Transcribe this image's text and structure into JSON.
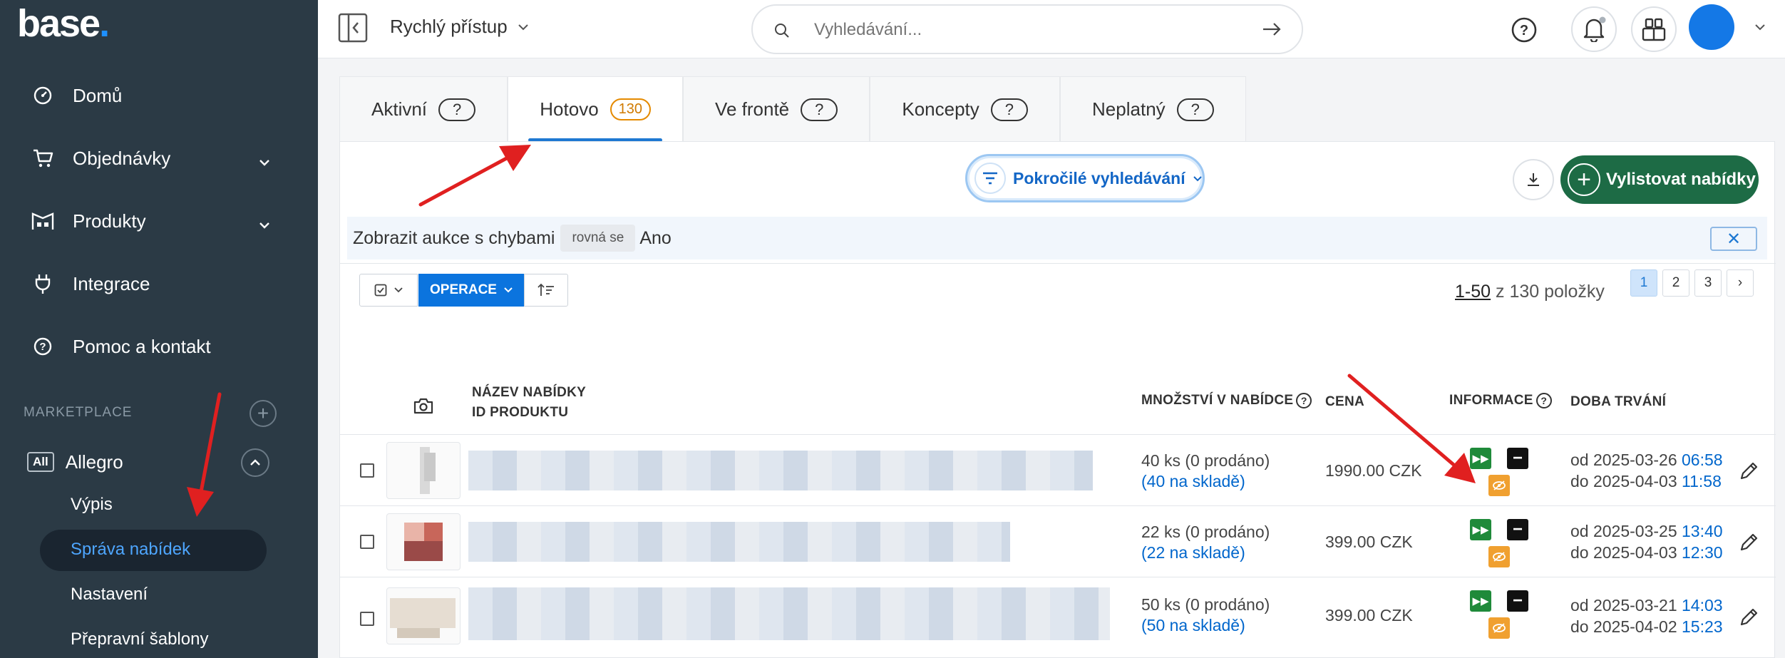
{
  "sidebar": {
    "logo": "base",
    "nav": [
      {
        "label": "Domů",
        "icon": "dashboard-icon"
      },
      {
        "label": "Objednávky",
        "icon": "cart-icon"
      },
      {
        "label": "Produkty",
        "icon": "warehouse-icon"
      },
      {
        "label": "Integrace",
        "icon": "plug-icon"
      },
      {
        "label": "Pomoc a kontakt",
        "icon": "help-icon"
      }
    ],
    "marketplace_label": "MARKETPLACE",
    "allegro_badge": "All",
    "allegro_label": "Allegro",
    "sub_items": [
      "Výpis",
      "Správa nabídek",
      "Nastavení",
      "Přepravní šablony"
    ]
  },
  "topbar": {
    "quick_access": "Rychlý přístup",
    "search_placeholder": "Vyhledávání..."
  },
  "tabs": [
    {
      "label": "Aktivní",
      "count": "?"
    },
    {
      "label": "Hotovo",
      "count": "130"
    },
    {
      "label": "Ve frontě",
      "count": "?"
    },
    {
      "label": "Koncepty",
      "count": "?"
    },
    {
      "label": "Neplatný",
      "count": "?"
    }
  ],
  "toolbar": {
    "advanced_search": "Pokročilé vyhledávání",
    "list_offers": "Vylistovat nabídky",
    "operations": "OPERACE"
  },
  "filter": {
    "field": "Zobrazit aukce s chybami",
    "operator": "rovná se",
    "value": "Ano",
    "close": "✕"
  },
  "pagination": {
    "range": "1-50",
    "of_text": "z 130 položky",
    "pages": [
      "1",
      "2",
      "3",
      "›"
    ]
  },
  "table": {
    "headers": {
      "name": "NÁZEV NABÍDKY",
      "product_id": "ID PRODUKTU",
      "qty": "MNOŽSTVÍ V NABÍDCE",
      "price": "CENA",
      "info": "INFORMACE",
      "duration": "DOBA TRVÁNÍ"
    },
    "rows": [
      {
        "qty": "40 ks (0 prodáno)",
        "stock": "(40 na skladě)",
        "price": "1990.00 CZK",
        "from_date": "od 2025-03-26",
        "from_time": "06:58",
        "to_date": "do 2025-04-03",
        "to_time": "11:58"
      },
      {
        "qty": "22 ks (0 prodáno)",
        "stock": "(22 na skladě)",
        "price": "399.00 CZK",
        "from_date": "od 2025-03-25",
        "from_time": "13:40",
        "to_date": "do 2025-04-03",
        "to_time": "12:30"
      },
      {
        "qty": "50 ks (0 prodáno)",
        "stock": "(50 na skladě)",
        "price": "399.00 CZK",
        "from_date": "od 2025-03-21",
        "from_time": "14:03",
        "to_date": "do 2025-04-02",
        "to_time": "15:23"
      }
    ]
  },
  "colors": {
    "sidebar_bg": "#2b3a45",
    "accent_blue": "#0b74de",
    "list_button_green": "#1d6b45",
    "annotation_red": "#e02020"
  }
}
